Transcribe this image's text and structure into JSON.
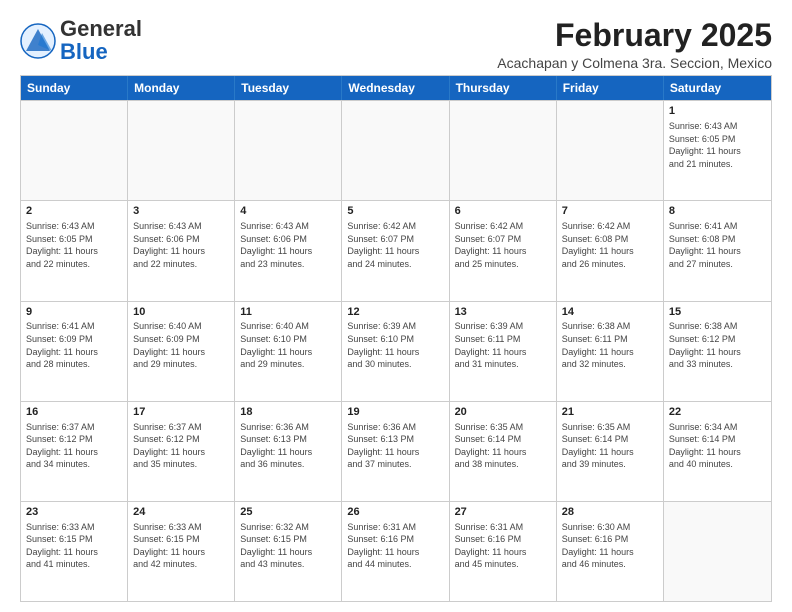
{
  "logo": {
    "general": "General",
    "blue": "Blue"
  },
  "title": "February 2025",
  "subtitle": "Acachapan y Colmena 3ra. Seccion, Mexico",
  "header_days": [
    "Sunday",
    "Monday",
    "Tuesday",
    "Wednesday",
    "Thursday",
    "Friday",
    "Saturday"
  ],
  "weeks": [
    [
      {
        "day": "",
        "info": ""
      },
      {
        "day": "",
        "info": ""
      },
      {
        "day": "",
        "info": ""
      },
      {
        "day": "",
        "info": ""
      },
      {
        "day": "",
        "info": ""
      },
      {
        "day": "",
        "info": ""
      },
      {
        "day": "1",
        "info": "Sunrise: 6:43 AM\nSunset: 6:05 PM\nDaylight: 11 hours\nand 21 minutes."
      }
    ],
    [
      {
        "day": "2",
        "info": "Sunrise: 6:43 AM\nSunset: 6:05 PM\nDaylight: 11 hours\nand 22 minutes."
      },
      {
        "day": "3",
        "info": "Sunrise: 6:43 AM\nSunset: 6:06 PM\nDaylight: 11 hours\nand 22 minutes."
      },
      {
        "day": "4",
        "info": "Sunrise: 6:43 AM\nSunset: 6:06 PM\nDaylight: 11 hours\nand 23 minutes."
      },
      {
        "day": "5",
        "info": "Sunrise: 6:42 AM\nSunset: 6:07 PM\nDaylight: 11 hours\nand 24 minutes."
      },
      {
        "day": "6",
        "info": "Sunrise: 6:42 AM\nSunset: 6:07 PM\nDaylight: 11 hours\nand 25 minutes."
      },
      {
        "day": "7",
        "info": "Sunrise: 6:42 AM\nSunset: 6:08 PM\nDaylight: 11 hours\nand 26 minutes."
      },
      {
        "day": "8",
        "info": "Sunrise: 6:41 AM\nSunset: 6:08 PM\nDaylight: 11 hours\nand 27 minutes."
      }
    ],
    [
      {
        "day": "9",
        "info": "Sunrise: 6:41 AM\nSunset: 6:09 PM\nDaylight: 11 hours\nand 28 minutes."
      },
      {
        "day": "10",
        "info": "Sunrise: 6:40 AM\nSunset: 6:09 PM\nDaylight: 11 hours\nand 29 minutes."
      },
      {
        "day": "11",
        "info": "Sunrise: 6:40 AM\nSunset: 6:10 PM\nDaylight: 11 hours\nand 29 minutes."
      },
      {
        "day": "12",
        "info": "Sunrise: 6:39 AM\nSunset: 6:10 PM\nDaylight: 11 hours\nand 30 minutes."
      },
      {
        "day": "13",
        "info": "Sunrise: 6:39 AM\nSunset: 6:11 PM\nDaylight: 11 hours\nand 31 minutes."
      },
      {
        "day": "14",
        "info": "Sunrise: 6:38 AM\nSunset: 6:11 PM\nDaylight: 11 hours\nand 32 minutes."
      },
      {
        "day": "15",
        "info": "Sunrise: 6:38 AM\nSunset: 6:12 PM\nDaylight: 11 hours\nand 33 minutes."
      }
    ],
    [
      {
        "day": "16",
        "info": "Sunrise: 6:37 AM\nSunset: 6:12 PM\nDaylight: 11 hours\nand 34 minutes."
      },
      {
        "day": "17",
        "info": "Sunrise: 6:37 AM\nSunset: 6:12 PM\nDaylight: 11 hours\nand 35 minutes."
      },
      {
        "day": "18",
        "info": "Sunrise: 6:36 AM\nSunset: 6:13 PM\nDaylight: 11 hours\nand 36 minutes."
      },
      {
        "day": "19",
        "info": "Sunrise: 6:36 AM\nSunset: 6:13 PM\nDaylight: 11 hours\nand 37 minutes."
      },
      {
        "day": "20",
        "info": "Sunrise: 6:35 AM\nSunset: 6:14 PM\nDaylight: 11 hours\nand 38 minutes."
      },
      {
        "day": "21",
        "info": "Sunrise: 6:35 AM\nSunset: 6:14 PM\nDaylight: 11 hours\nand 39 minutes."
      },
      {
        "day": "22",
        "info": "Sunrise: 6:34 AM\nSunset: 6:14 PM\nDaylight: 11 hours\nand 40 minutes."
      }
    ],
    [
      {
        "day": "23",
        "info": "Sunrise: 6:33 AM\nSunset: 6:15 PM\nDaylight: 11 hours\nand 41 minutes."
      },
      {
        "day": "24",
        "info": "Sunrise: 6:33 AM\nSunset: 6:15 PM\nDaylight: 11 hours\nand 42 minutes."
      },
      {
        "day": "25",
        "info": "Sunrise: 6:32 AM\nSunset: 6:15 PM\nDaylight: 11 hours\nand 43 minutes."
      },
      {
        "day": "26",
        "info": "Sunrise: 6:31 AM\nSunset: 6:16 PM\nDaylight: 11 hours\nand 44 minutes."
      },
      {
        "day": "27",
        "info": "Sunrise: 6:31 AM\nSunset: 6:16 PM\nDaylight: 11 hours\nand 45 minutes."
      },
      {
        "day": "28",
        "info": "Sunrise: 6:30 AM\nSunset: 6:16 PM\nDaylight: 11 hours\nand 46 minutes."
      },
      {
        "day": "",
        "info": ""
      }
    ]
  ]
}
